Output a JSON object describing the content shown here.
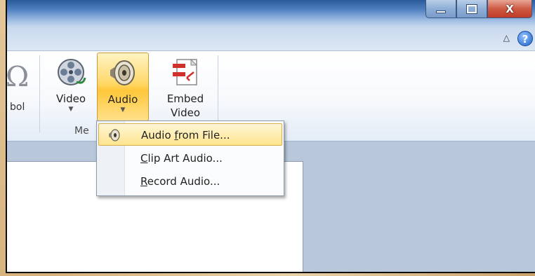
{
  "window": {
    "controls": {
      "minimize": "minimize",
      "maximize": "maximize",
      "close": "X"
    },
    "help": "?"
  },
  "ribbon": {
    "previous_button_label": "bol",
    "video": {
      "label": "Video",
      "icon": "film-reel-icon"
    },
    "audio": {
      "label": "Audio",
      "icon": "speaker-icon"
    },
    "embed_video": {
      "label_line1": "Embed",
      "label_line2": "Video",
      "icon": "embed-video-icon"
    },
    "group_label": "Me"
  },
  "audio_menu": {
    "items": [
      {
        "pre": "Audio ",
        "accel": "f",
        "post": "rom File...",
        "icon": "speaker-icon",
        "highlighted": true
      },
      {
        "pre": "",
        "accel": "C",
        "post": "lip Art Audio...",
        "highlighted": false
      },
      {
        "pre": "",
        "accel": "R",
        "post": "ecord Audio...",
        "highlighted": false
      }
    ]
  },
  "colors": {
    "highlight": "#ffd869",
    "title_bar": "#4f7fbf",
    "close_button": "#cf5a44"
  }
}
